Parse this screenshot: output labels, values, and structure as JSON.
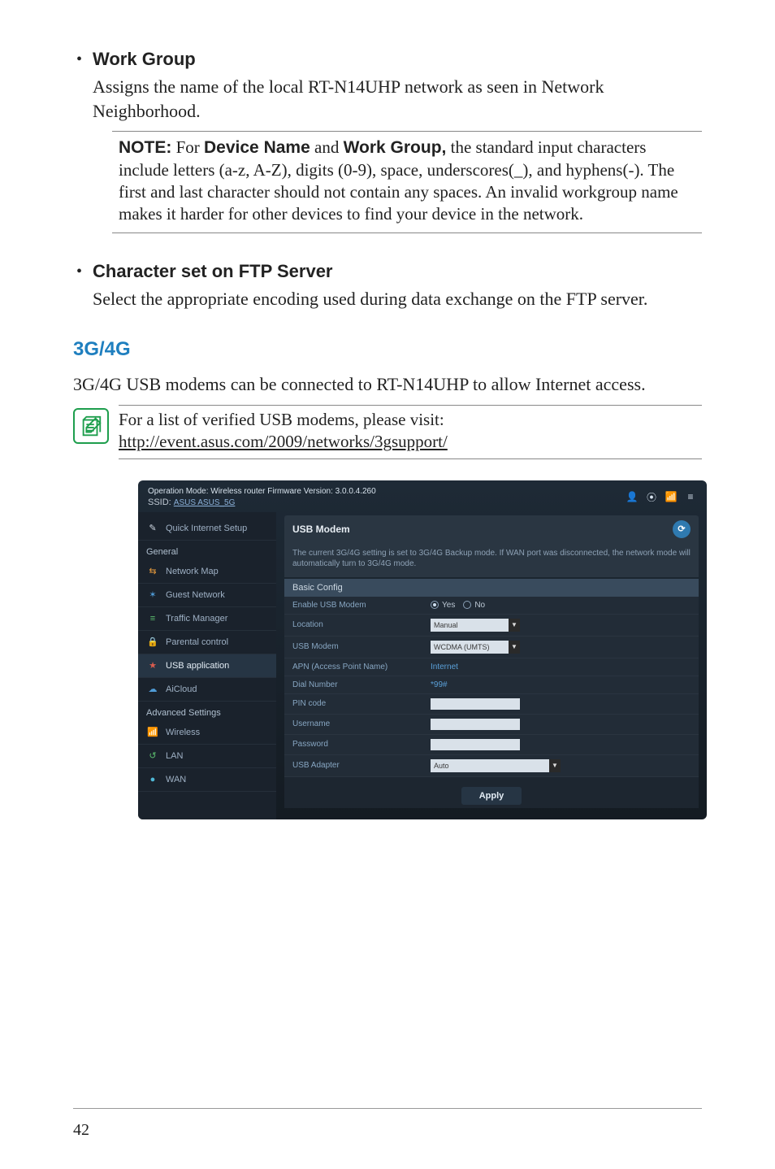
{
  "doc": {
    "items": [
      {
        "title": "Work Group",
        "body": "Assigns the name of the local RT-N14UHP network as seen in Network Neighborhood."
      },
      {
        "title": "Character set on FTP Server",
        "body": "Select the appropriate encoding used during data exchange on the FTP server."
      }
    ],
    "note": {
      "label": "NOTE:",
      "t1": " For ",
      "b1": "Device Name",
      "t2": " and ",
      "b2": "Work Group,",
      "t3": " the standard input characters include letters (a-z, A-Z), digits (0-9), space, underscores(_), and hyphens(-). The first and last character should not contain any spaces. An invalid workgroup name makes it harder for other devices to find your device in the network."
    },
    "section_heading": "3G/4G",
    "section_body": "3G/4G USB modems can be connected to RT-N14UHP to allow Internet access.",
    "info": {
      "line": "For a list of verified USB modems, please visit:",
      "link": "http://event.asus.com/2009/networks/3gsupport/"
    }
  },
  "ui": {
    "top": {
      "mode_line": "Operation Mode: Wireless router   Firmware Version: 3.0.0.4.260",
      "ssid_label": "SSID:",
      "ssid": "ASUS  ASUS_5G"
    },
    "sidebar": {
      "quick": "Quick Internet Setup",
      "cat1": "General",
      "items1": [
        {
          "icon": "ic-orange",
          "glyph": "⇆",
          "label": "Network Map"
        },
        {
          "icon": "ic-blue",
          "glyph": "✶",
          "label": "Guest Network"
        },
        {
          "icon": "ic-green",
          "glyph": "≡",
          "label": "Traffic Manager"
        },
        {
          "icon": "ic-orange",
          "glyph": "🔒",
          "label": "Parental control"
        },
        {
          "icon": "ic-red",
          "glyph": "★",
          "label": "USB application"
        },
        {
          "icon": "ic-blue",
          "glyph": "☁",
          "label": "AiCloud"
        }
      ],
      "cat2": "Advanced Settings",
      "items2": [
        {
          "icon": "ic-cyan",
          "glyph": "📶",
          "label": "Wireless"
        },
        {
          "icon": "ic-green",
          "glyph": "↺",
          "label": "LAN"
        },
        {
          "icon": "ic-cyan",
          "glyph": "●",
          "label": "WAN"
        }
      ]
    },
    "panel": {
      "title": "USB Modem",
      "desc": "The current 3G/4G setting is set to 3G/4G Backup mode. If WAN port was disconnected, the network mode will automatically turn to 3G/4G mode.",
      "subhead": "Basic Config",
      "rows": [
        {
          "label": "Enable USB Modem",
          "type": "radio",
          "yes": "Yes",
          "no": "No"
        },
        {
          "label": "Location",
          "type": "select",
          "value": "Manual"
        },
        {
          "label": "USB Modem",
          "type": "select",
          "value": "WCDMA (UMTS)"
        },
        {
          "label": "APN (Access Point Name)",
          "type": "link",
          "value": "Internet"
        },
        {
          "label": "Dial Number",
          "type": "text",
          "value": "*99#"
        },
        {
          "label": "PIN code",
          "type": "text",
          "value": ""
        },
        {
          "label": "Username",
          "type": "text",
          "value": ""
        },
        {
          "label": "Password",
          "type": "text",
          "value": ""
        },
        {
          "label": "USB Adapter",
          "type": "select",
          "value": "Auto"
        }
      ],
      "apply": "Apply"
    }
  },
  "page_number": "42"
}
